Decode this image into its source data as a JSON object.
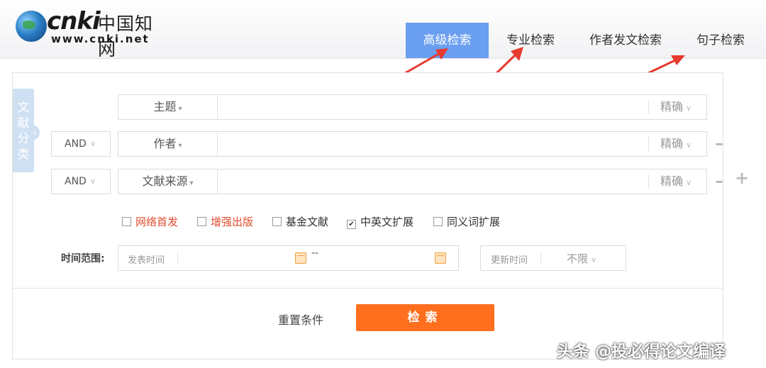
{
  "logo": {
    "brand": "cnki",
    "cn_name": "中国知网",
    "url": "www.cnki.net"
  },
  "tabs": [
    {
      "label": "高级检索",
      "active": true
    },
    {
      "label": "专业检索",
      "active": false
    },
    {
      "label": "作者发文检索",
      "active": false
    },
    {
      "label": "句子检索",
      "active": false
    }
  ],
  "side_tab": {
    "label": "文献分类"
  },
  "rows": [
    {
      "logic": "",
      "field": "主题",
      "match": "精确"
    },
    {
      "logic": "AND",
      "field": "作者",
      "match": "精确"
    },
    {
      "logic": "AND",
      "field": "文献来源",
      "match": "精确"
    }
  ],
  "checkboxes": [
    {
      "label": "网络首发",
      "checked": false,
      "color": "#e24c2e"
    },
    {
      "label": "增强出版",
      "checked": false,
      "color": "#e24c2e"
    },
    {
      "label": "基金文献",
      "checked": false
    },
    {
      "label": "中英文扩展",
      "checked": true
    },
    {
      "label": "同义词扩展",
      "checked": false
    }
  ],
  "time": {
    "label": "时间范围:",
    "publish_placeholder": "发表时间",
    "range_sep": "--",
    "update_label": "更新时间",
    "update_value": "不限"
  },
  "actions": {
    "reset": "重置条件",
    "search": "检索"
  },
  "watermark": "头条 @投必得论文编译",
  "colors": {
    "accent_tab": "#6a9ef0",
    "search_button": "#ff6f1d",
    "arrow": "#e63a2e"
  },
  "icons": [
    "globe-logo-icon",
    "calendar-icon",
    "chevron-down-icon",
    "minus-icon",
    "plus-icon",
    "checkbox-icon"
  ]
}
